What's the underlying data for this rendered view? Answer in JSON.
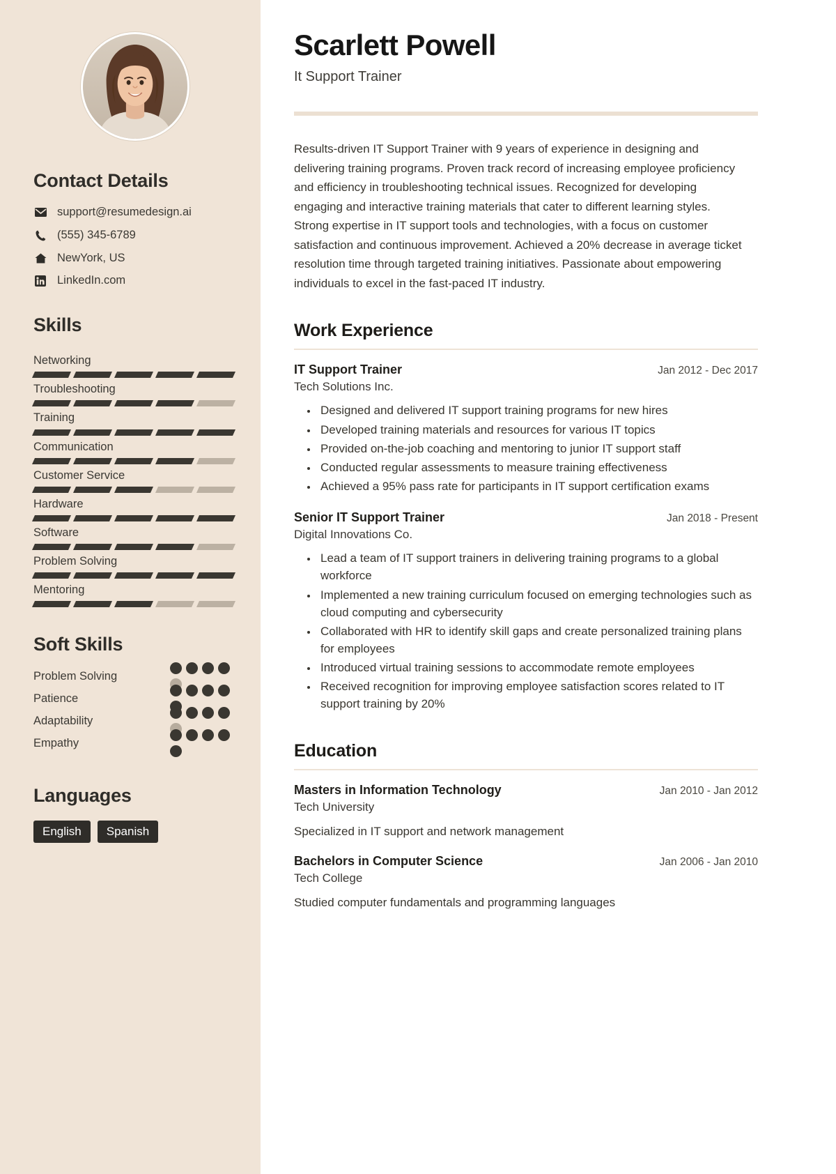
{
  "header": {
    "name": "Scarlett Powell",
    "role": "It Support Trainer"
  },
  "summary": "Results-driven IT Support Trainer with 9 years of experience in designing and delivering training programs. Proven track record of increasing employee proficiency and efficiency in troubleshooting technical issues. Recognized for developing engaging and interactive training materials that cater to different learning styles. Strong expertise in IT support tools and technologies, with a focus on customer satisfaction and continuous improvement. Achieved a 20% decrease in average ticket resolution time through targeted training initiatives. Passionate about empowering individuals to excel in the fast-paced IT industry.",
  "sidebar": {
    "contact_heading": "Contact Details",
    "contacts": [
      {
        "icon": "envelope-icon",
        "text": "support@resumedesign.ai"
      },
      {
        "icon": "phone-icon",
        "text": "(555) 345-6789"
      },
      {
        "icon": "home-icon",
        "text": "NewYork, US"
      },
      {
        "icon": "linkedin-icon",
        "text": "LinkedIn.com"
      }
    ],
    "skills_heading": "Skills",
    "skills": [
      {
        "name": "Networking",
        "level": 5,
        "max": 5
      },
      {
        "name": "Troubleshooting",
        "level": 4,
        "max": 5
      },
      {
        "name": "Training",
        "level": 5,
        "max": 5
      },
      {
        "name": "Communication",
        "level": 4,
        "max": 5
      },
      {
        "name": "Customer Service",
        "level": 3,
        "max": 5
      },
      {
        "name": "Hardware",
        "level": 5,
        "max": 5
      },
      {
        "name": "Software",
        "level": 4,
        "max": 5
      },
      {
        "name": "Problem Solving",
        "level": 5,
        "max": 5
      },
      {
        "name": "Mentoring",
        "level": 3,
        "max": 5
      }
    ],
    "soft_skills_heading": "Soft Skills",
    "soft_skills": [
      {
        "name": "Problem Solving",
        "level": 4,
        "max": 5
      },
      {
        "name": "Patience",
        "level": 5,
        "max": 5
      },
      {
        "name": "Adaptability",
        "level": 4,
        "max": 5
      },
      {
        "name": "Empathy",
        "level": 5,
        "max": 5
      }
    ],
    "languages_heading": "Languages",
    "languages": [
      "English",
      "Spanish"
    ]
  },
  "work": {
    "heading": "Work Experience",
    "entries": [
      {
        "title": "IT Support Trainer",
        "org": "Tech Solutions Inc.",
        "date": "Jan 2012 - Dec 2017",
        "bullets": [
          "Designed and delivered IT support training programs for new hires",
          "Developed training materials and resources for various IT topics",
          "Provided on-the-job coaching and mentoring to junior IT support staff",
          "Conducted regular assessments to measure training effectiveness",
          "Achieved a 95% pass rate for participants in IT support certification exams"
        ]
      },
      {
        "title": "Senior IT Support Trainer",
        "org": "Digital Innovations Co.",
        "date": "Jan 2018 - Present",
        "bullets": [
          "Lead a team of IT support trainers in delivering training programs to a global workforce",
          "Implemented a new training curriculum focused on emerging technologies such as cloud computing and cybersecurity",
          "Collaborated with HR to identify skill gaps and create personalized training plans for employees",
          "Introduced virtual training sessions to accommodate remote employees",
          "Received recognition for improving employee satisfaction scores related to IT support training by 20%"
        ]
      }
    ]
  },
  "education": {
    "heading": "Education",
    "entries": [
      {
        "title": "Masters in Information Technology",
        "org": "Tech University",
        "date": "Jan 2010 - Jan 2012",
        "desc": "Specialized in IT support and network management"
      },
      {
        "title": "Bachelors in Computer Science",
        "org": "Tech College",
        "date": "Jan 2006 - Jan 2010",
        "desc": "Studied computer fundamentals and programming languages"
      }
    ]
  },
  "colors": {
    "sidebar_bg": "#f0e4d7",
    "accent_rule": "#ece0d2",
    "bar_on": "#3a3731",
    "bar_off": "#bcb1a3",
    "chip_bg": "#2f2d29",
    "text": "#3b3934"
  }
}
